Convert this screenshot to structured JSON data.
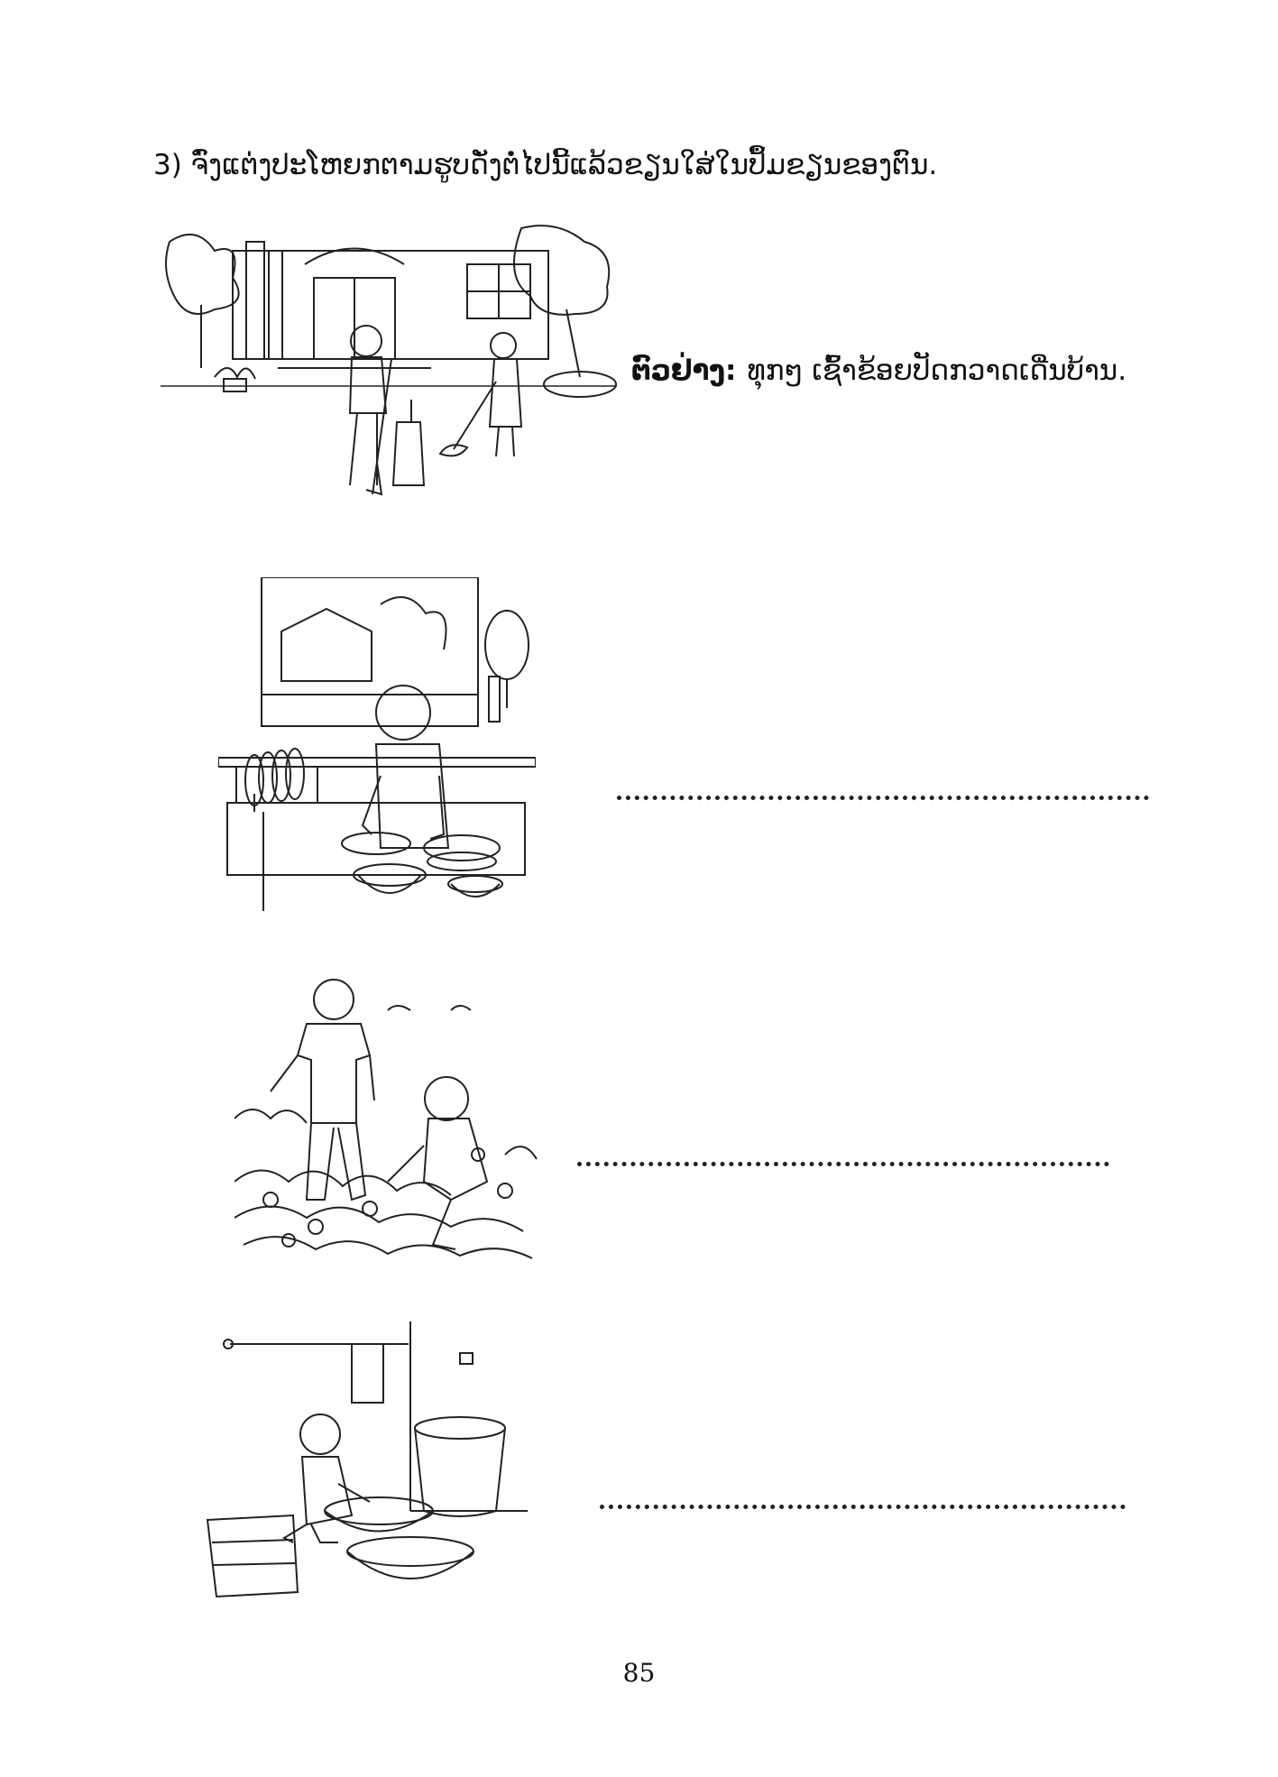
{
  "instruction": "3)  ຈົ່ງແຕ່ງປະໂຫຍກຕາມຮູບດັ່ງຕໍ່ໄປນີ້ແລ້ວຂຽນໃສ່ໃນປຶ້ມຂຽນຂອງຕົນ.",
  "example": {
    "label": "ຕົວຢ່າງ:",
    "sentence": "ທຸກໆ ເຊົ້າຂ້ອຍປັດກວາດເດີ່ນບ້ານ."
  },
  "page_number": "85"
}
